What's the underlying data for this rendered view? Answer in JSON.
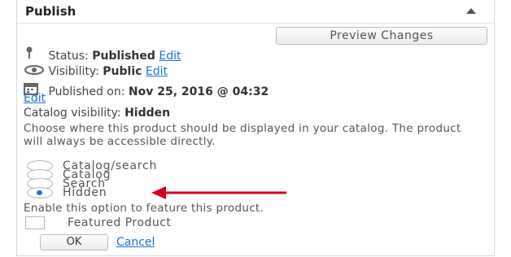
{
  "panel": {
    "title": "Publish",
    "preview_button": "Preview Changes"
  },
  "status": {
    "label": "Status:",
    "value": "Published",
    "edit": "Edit"
  },
  "visibility": {
    "label": "Visibility:",
    "value": "Public",
    "edit": "Edit"
  },
  "published": {
    "label": "Published on:",
    "value": "Nov 25, 2016 @ 04:32",
    "edit": "Edit"
  },
  "catalog": {
    "label": "Catalog visibility:",
    "value": "Hidden",
    "description": "Choose where this product should be displayed in your catalog. The product will always be accessible directly.",
    "options": [
      "Catalog/search",
      "Catalog",
      "Search",
      "Hidden"
    ],
    "selected": "Hidden"
  },
  "featured": {
    "description": "Enable this option to feature this product.",
    "checkbox_label": "Featured Product"
  },
  "actions": {
    "ok": "OK",
    "cancel": "Cancel"
  },
  "colors": {
    "link": "#1a73d6",
    "arrow": "#d0021b",
    "radio_selected": "#1e73be"
  }
}
